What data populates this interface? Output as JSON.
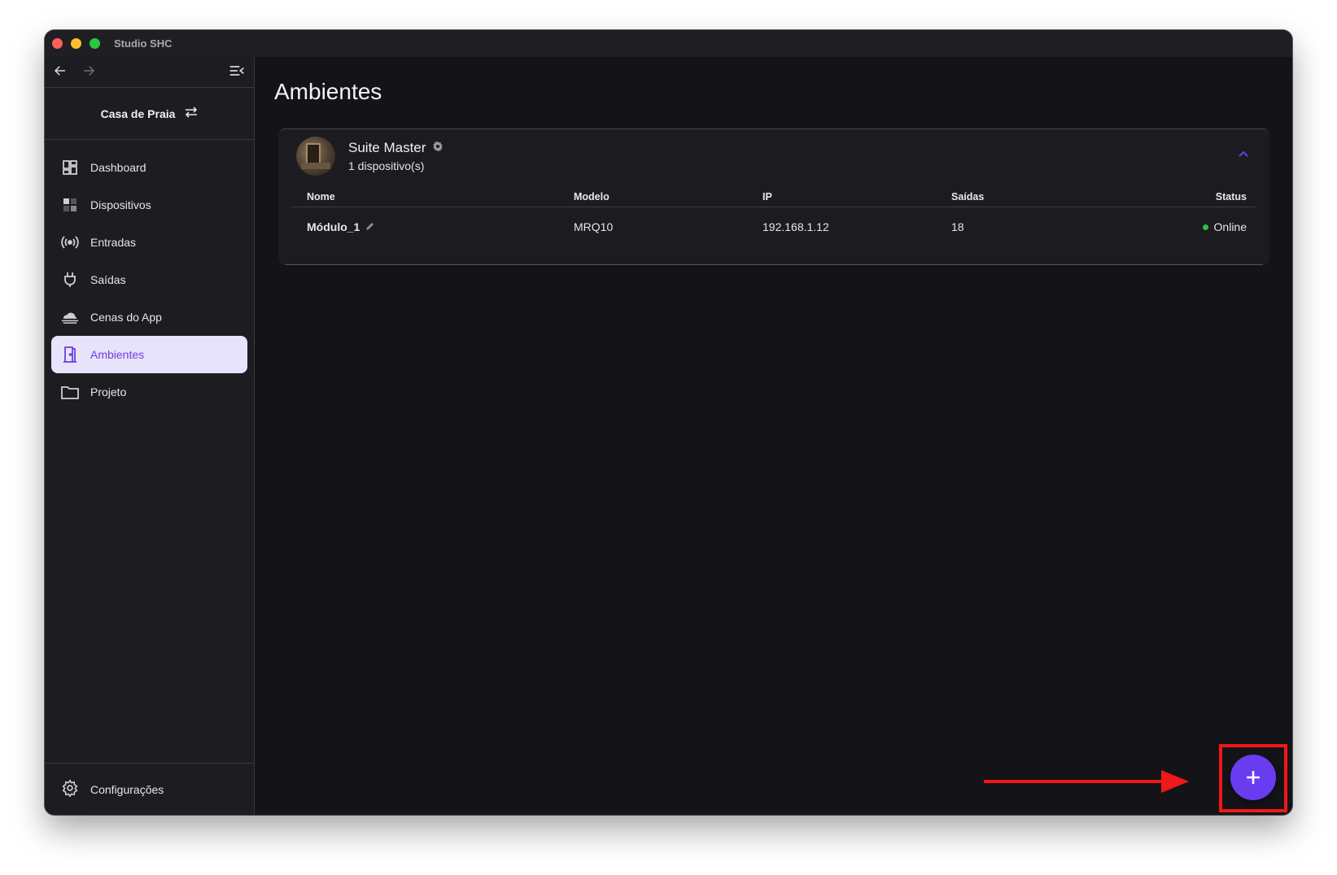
{
  "window": {
    "title": "Studio SHC"
  },
  "sidebar": {
    "project_name": "Casa de Praia",
    "items": [
      {
        "label": "Dashboard",
        "icon": "dashboard-icon",
        "active": false
      },
      {
        "label": "Dispositivos",
        "icon": "devices-icon",
        "active": false
      },
      {
        "label": "Entradas",
        "icon": "broadcast-icon",
        "active": false
      },
      {
        "label": "Saídas",
        "icon": "plug-icon",
        "active": false
      },
      {
        "label": "Cenas do App",
        "icon": "cloud-icon",
        "active": false
      },
      {
        "label": "Ambientes",
        "icon": "door-icon",
        "active": true
      },
      {
        "label": "Projeto",
        "icon": "folder-icon",
        "active": false
      }
    ],
    "settings_label": "Configurações"
  },
  "main": {
    "title": "Ambientes",
    "room": {
      "name": "Suite Master",
      "device_count": "1 dispositivo(s)",
      "columns": [
        "Nome",
        "Modelo",
        "IP",
        "Saídas",
        "Status"
      ],
      "rows": [
        {
          "nome": "Módulo_1",
          "modelo": "MRQ10",
          "ip": "192.168.1.12",
          "saidas": "18",
          "status": "Online"
        }
      ]
    },
    "fab_symbol": "+"
  },
  "colors": {
    "accent": "#6a3cf0",
    "active_bg": "#e7e3fb",
    "online": "#2fbf4d",
    "annotation": "#f01818"
  }
}
